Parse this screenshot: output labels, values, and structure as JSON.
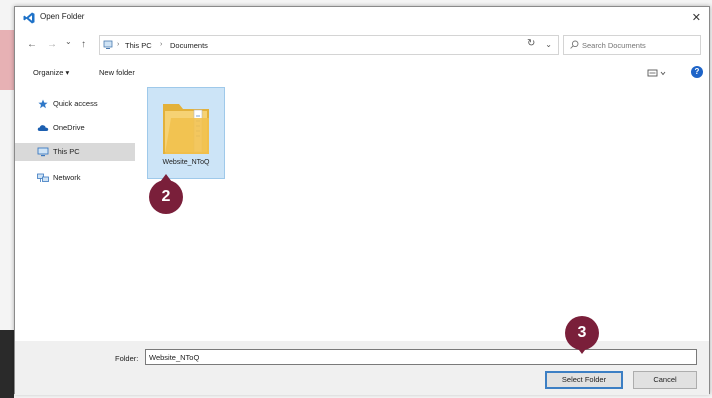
{
  "window": {
    "title": "Open Folder",
    "close_glyph": "✕"
  },
  "nav": {
    "back_glyph": "←",
    "forward_glyph": "→",
    "recent_glyph": "⌄",
    "up_glyph": "↑",
    "breadcrumb": [
      "This PC",
      "Documents"
    ],
    "breadcrumb_sep": "›",
    "dropdown_glyph": "⌄",
    "refresh_glyph": "↻",
    "search_placeholder": "Search Documents"
  },
  "commands": {
    "organize": "Organize ▾",
    "new_folder": "New folder",
    "help": "?"
  },
  "sidebar": {
    "items": [
      {
        "label": "Quick access",
        "icon": "star-icon"
      },
      {
        "label": "OneDrive",
        "icon": "cloud-icon"
      },
      {
        "label": "This PC",
        "icon": "monitor-icon",
        "active": true
      },
      {
        "label": "Network",
        "icon": "network-icon"
      }
    ]
  },
  "content": {
    "items": [
      {
        "name": "Website_NToQ",
        "icon": "folder-icon",
        "selected": true
      }
    ]
  },
  "footer": {
    "folder_label": "Folder:",
    "folder_value": "Website_NToQ",
    "select_button": "Select Folder",
    "cancel_button": "Cancel"
  },
  "annotations": {
    "step2": "2",
    "step3": "3"
  },
  "colors": {
    "accent": "#3c7fc4",
    "badge": "#7a1f3a",
    "selection": "#cce4f7",
    "vs_blue": "#1e72c8"
  }
}
